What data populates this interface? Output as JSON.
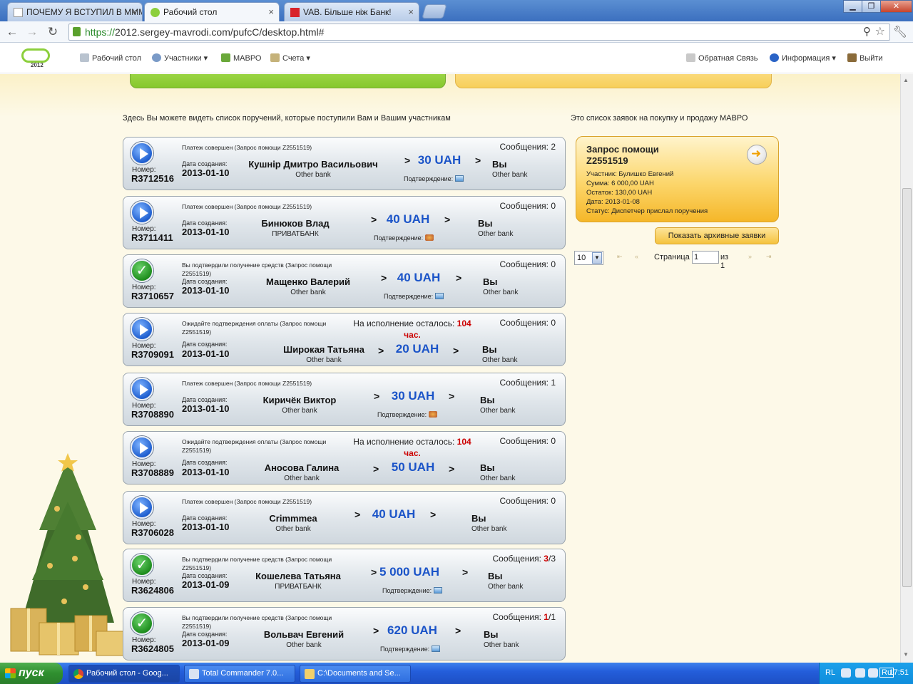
{
  "browser": {
    "tabs": [
      {
        "title": "ПОЧЕМУ Я ВСТУПИЛ В МММ",
        "close": "×"
      },
      {
        "title": "Рабочий стол",
        "close": "×"
      },
      {
        "title": "VAB. Більше ніж Банк!",
        "close": "×"
      }
    ],
    "url_scheme": "https://",
    "url_rest": "2012.sergey-mavrodi.com/pufcC/desktop.html#",
    "window_buttons": {
      "minimize": "▁",
      "maximize": "❐",
      "close": "✕"
    }
  },
  "site": {
    "logo_year": "2012",
    "nav_left": [
      {
        "label": "Рабочий стол"
      },
      {
        "label": "Участники ▾"
      },
      {
        "label": "МАВРО"
      },
      {
        "label": "Счета ▾"
      }
    ],
    "nav_right": [
      {
        "label": "Обратная Связь"
      },
      {
        "label": "Информация ▾"
      },
      {
        "label": "Выйти"
      }
    ]
  },
  "main": {
    "intro_left": "Здесь Вы можете видеть список поручений, которые поступили Вам и Вашим участникам",
    "intro_right": "Это список заявок на покупку и продажу МАВРО",
    "labels": {
      "number": "Номер:",
      "created": "Дата создания:",
      "confirm": "Подтверждение:",
      "you": "Вы",
      "you_bank": "Other bank",
      "gt": ">"
    },
    "orders": [
      {
        "status_icon": "play",
        "status": "Платеж совершен (Запрос помощи Z2551519)",
        "messages": "Сообщения: 2",
        "messages_hl": "",
        "messages_tail": "",
        "timer_prefix": "",
        "timer_hours": "",
        "timer_unit": "",
        "number": "R3712516",
        "date": "2013-01-10",
        "sender": "Кушнір Дмитро Васильович",
        "sender_bank": "Other bank",
        "amount": "30 UAH",
        "confirm_icon": "img"
      },
      {
        "status_icon": "play",
        "status": "Платеж совершен (Запрос помощи Z2551519)",
        "messages": "Сообщения: 0",
        "messages_hl": "",
        "messages_tail": "",
        "timer_prefix": "",
        "timer_hours": "",
        "timer_unit": "",
        "number": "R3711411",
        "date": "2013-01-10",
        "sender": "Бинюков Влад",
        "sender_bank": "ПРИВАТБАНК",
        "amount": "40 UAH",
        "confirm_icon": "star"
      },
      {
        "status_icon": "ok",
        "status": "Вы подтвердили получение средств (Запрос помощи Z2551519)",
        "messages": "Сообщения: 0",
        "messages_hl": "",
        "messages_tail": "",
        "timer_prefix": "",
        "timer_hours": "",
        "timer_unit": "",
        "number": "R3710657",
        "date": "2013-01-10",
        "sender": "Мащенко Валерий",
        "sender_bank": "Other bank",
        "amount": "40 UAH",
        "confirm_icon": "img"
      },
      {
        "status_icon": "play",
        "status": "Ожидайте подтверждения оплаты (Запрос помощи Z2551519)",
        "messages": "Сообщения: 0",
        "messages_hl": "",
        "messages_tail": "",
        "timer_prefix": "На исполнение осталось: ",
        "timer_hours": "104",
        "timer_unit": "час.",
        "number": "R3709091",
        "date": "2013-01-10",
        "sender": "Широкая Татьяна",
        "sender_bank": "Other bank",
        "amount": "20 UAH",
        "confirm_icon": ""
      },
      {
        "status_icon": "play",
        "status": "Платеж совершен (Запрос помощи Z2551519)",
        "messages": "Сообщения: 1",
        "messages_hl": "",
        "messages_tail": "",
        "timer_prefix": "",
        "timer_hours": "",
        "timer_unit": "",
        "number": "R3708890",
        "date": "2013-01-10",
        "sender": "Киричёк Виктор",
        "sender_bank": "Other bank",
        "amount": "30 UAH",
        "confirm_icon": "star"
      },
      {
        "status_icon": "play",
        "status": "Ожидайте подтверждения оплаты (Запрос помощи Z2551519)",
        "messages": "Сообщения: 0",
        "messages_hl": "",
        "messages_tail": "",
        "timer_prefix": "На исполнение осталось: ",
        "timer_hours": "104",
        "timer_unit": "час.",
        "number": "R3708889",
        "date": "2013-01-10",
        "sender": "Аносова Галина",
        "sender_bank": "Other bank",
        "amount": "50 UAH",
        "confirm_icon": ""
      },
      {
        "status_icon": "play",
        "status": "Платеж совершен (Запрос помощи Z2551519)",
        "messages": "Сообщения: 0",
        "messages_hl": "",
        "messages_tail": "",
        "timer_prefix": "",
        "timer_hours": "",
        "timer_unit": "",
        "number": "R3706028",
        "date": "2013-01-10",
        "sender": "Crimmmea",
        "sender_bank": "Other bank",
        "amount": "40 UAH",
        "confirm_icon": ""
      },
      {
        "status_icon": "ok",
        "status": "Вы подтвердили получение средств (Запрос помощи Z2551519)",
        "messages": "Сообщения: ",
        "messages_hl": "3",
        "messages_tail": "/3",
        "timer_prefix": "",
        "timer_hours": "",
        "timer_unit": "",
        "number": "R3624806",
        "date": "2013-01-09",
        "sender": "Кошелева Татьяна",
        "sender_bank": "ПРИВАТБАНК",
        "amount": "5 000 UAH",
        "confirm_icon": "img"
      },
      {
        "status_icon": "ok",
        "status": "Вы подтвердили получение средств (Запрос помощи Z2551519)",
        "messages": "Сообщения: ",
        "messages_hl": "1",
        "messages_tail": "/1",
        "timer_prefix": "",
        "timer_hours": "",
        "timer_unit": "",
        "number": "R3624805",
        "date": "2013-01-09",
        "sender": "Вольвач Евгений",
        "sender_bank": "Other bank",
        "amount": "620 UAH",
        "confirm_icon": "img"
      }
    ]
  },
  "request": {
    "title": "Запрос помощи",
    "id": "Z2551519",
    "participant": "Участник: Булишко Евгений",
    "sum": "Сумма: 6 000,00 UAH",
    "rest": "Остаток: 130,00 UAH",
    "date": "Дата: 2013-01-08",
    "status": "Статус: Диспетчер прислал поручения",
    "archive_button": "Показать архивные заявки"
  },
  "pager": {
    "per_page": "10",
    "page_label": "Страница",
    "page_value": "1",
    "of_label": "из 1",
    "first": "⇤",
    "prev": "«",
    "next": "»",
    "last": "⇥"
  },
  "taskbar": {
    "start": "пуск",
    "tasks": [
      {
        "label": "Рабочий стол - Goog..."
      },
      {
        "label": "Total Commander 7.0..."
      },
      {
        "label": "C:\\Documents and Se..."
      }
    ],
    "lang": "RL",
    "kbd": "Ru",
    "clock": "17:51"
  }
}
